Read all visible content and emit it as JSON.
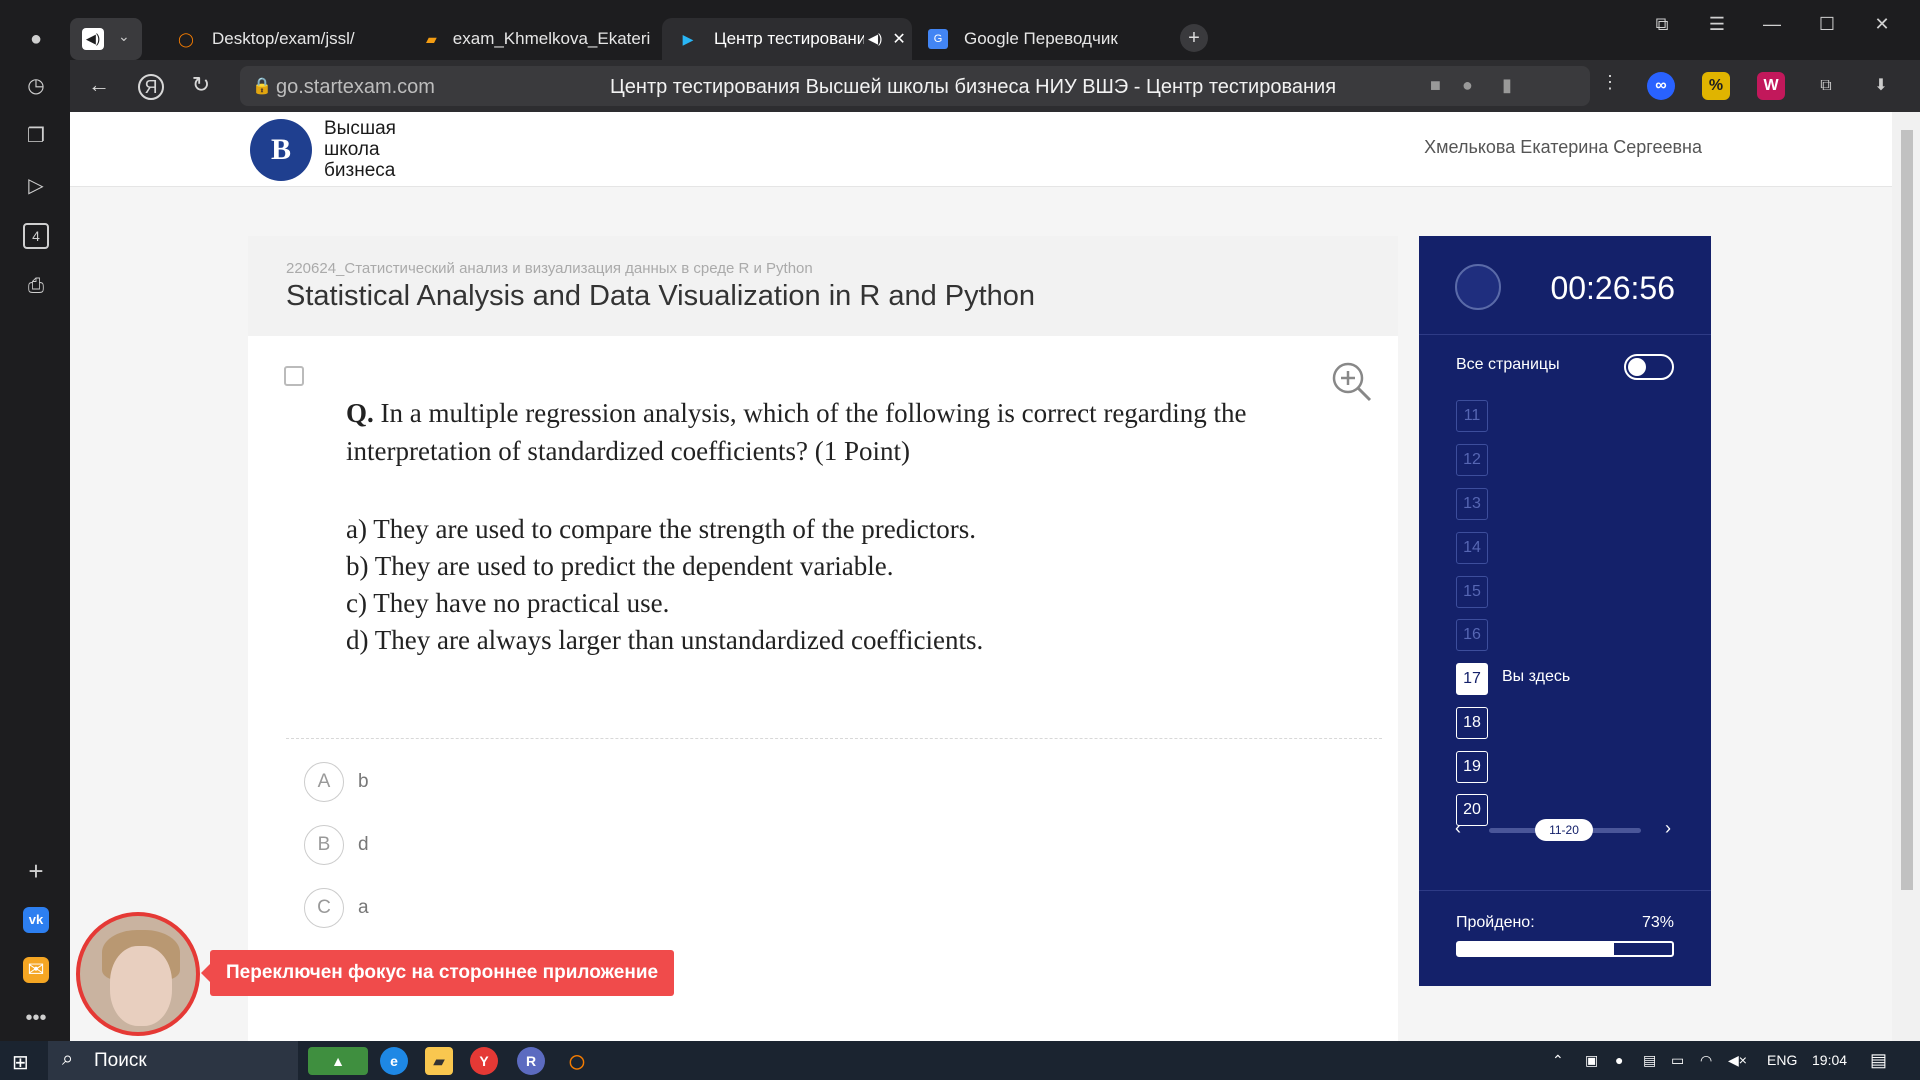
{
  "browser": {
    "tabs": [
      {
        "label": "Desktop/exam/jssl/"
      },
      {
        "label": "exam_Khmelkova_Ekaterin"
      },
      {
        "label": "Центр тестирования",
        "active": true
      },
      {
        "label": "Google Переводчик"
      }
    ],
    "sidebar_badge": "4",
    "url": "go.startexam.com",
    "page_title": "Центр тестирования Высшей школы бизнеса НИУ ВШЭ - Центр тестирования"
  },
  "header": {
    "logo_letter": "В",
    "logo_lines": [
      "Высшая",
      "школа",
      "бизнеса"
    ],
    "user_name": "Хмелькова Екатерина Сергеевна"
  },
  "exam": {
    "subtitle": "220624_Статистический анализ и визуализация данных в среде R и Python",
    "course_title": "Statistical Analysis and Data Visualization in R and Python",
    "question_prefix": "Q.",
    "question_text": "In a multiple regression analysis, which of the following is correct regarding the interpretation of standardized coefficients? (1 Point)",
    "options": [
      "a) They are used to compare the strength of the predictors.",
      "b) They are used to predict the dependent variable.",
      "c) They have no practical use.",
      "d) They are always larger than unstandardized coefficients."
    ],
    "answers": [
      {
        "letter": "A",
        "text": "b"
      },
      {
        "letter": "B",
        "text": "d"
      },
      {
        "letter": "C",
        "text": "a"
      }
    ]
  },
  "nav": {
    "timer": "00:26:56",
    "all_pages_label": "Все страницы",
    "questions": [
      "11",
      "12",
      "13",
      "14",
      "15",
      "16",
      "17",
      "18",
      "19",
      "20"
    ],
    "current": "17",
    "here_label": "Вы здесь",
    "range_label": "11-20",
    "passed_label": "Пройдено:",
    "passed_pct": "73%",
    "passed_fraction": 0.73
  },
  "proctor": {
    "alert": "Переключен фокус на стороннее приложение"
  },
  "taskbar": {
    "search_label": "Поиск",
    "lang": "ENG",
    "time": "19:04"
  }
}
